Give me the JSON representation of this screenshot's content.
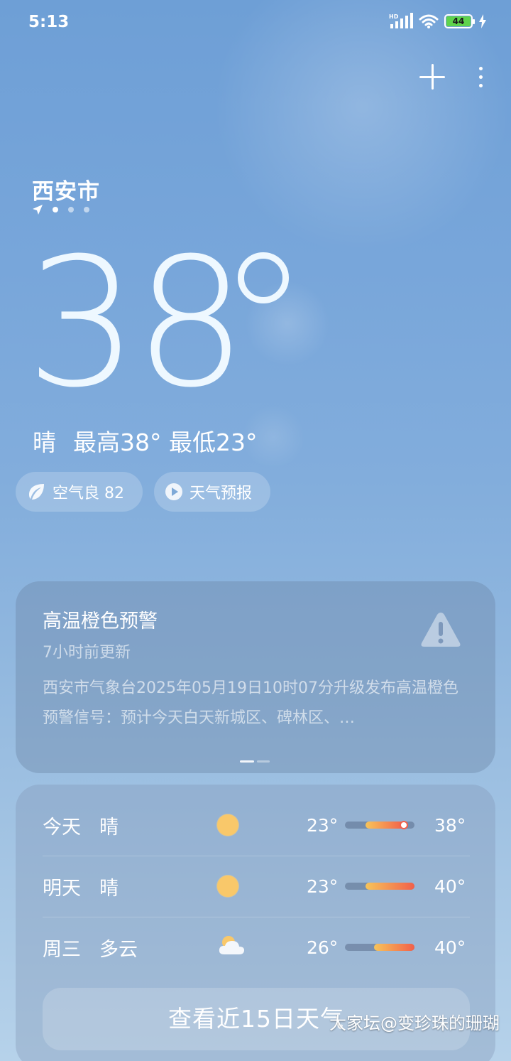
{
  "status_bar": {
    "time": "5:13",
    "network_label": "HD",
    "battery": "44",
    "battery_color": "#5fd34c"
  },
  "header": {
    "add_icon": "plus-icon",
    "menu_icon": "more-vertical-icon"
  },
  "location": {
    "city": "西安市",
    "page_count": 3,
    "active_page": 0
  },
  "current": {
    "temperature": "38",
    "condition": "晴",
    "high_low": "最高38° 最低23°"
  },
  "chips": {
    "air_quality": "空气良 82",
    "forecast_video": "天气预报"
  },
  "alert": {
    "title": "高温橙色预警",
    "updated": "7小时前更新",
    "body": "西安市气象台2025年05月19日10时07分升级发布高温橙色预警信号：预计今天白天新城区、碑林区、…",
    "icon": "warning-triangle-icon"
  },
  "forecast": {
    "days": [
      {
        "day": "今天",
        "condition": "晴",
        "icon": "sun-icon",
        "low": "23°",
        "high": "38°",
        "bar_start": 0.3,
        "bar_end": 0.85,
        "current_marker": 0.85
      },
      {
        "day": "明天",
        "condition": "晴",
        "icon": "sun-icon",
        "low": "23°",
        "high": "40°",
        "bar_start": 0.3,
        "bar_end": 1.0
      },
      {
        "day": "周三",
        "condition": "多云",
        "icon": "partly-cloudy-icon",
        "low": "26°",
        "high": "40°",
        "bar_start": 0.42,
        "bar_end": 1.0
      }
    ],
    "more_button": "查看近15日天气"
  },
  "watermark": "大家坛@变珍珠的珊瑚",
  "colors": {
    "bar_gradient_start": "#f7c45a",
    "bar_gradient_end": "#f2604a",
    "sun": "#f9c86a"
  }
}
